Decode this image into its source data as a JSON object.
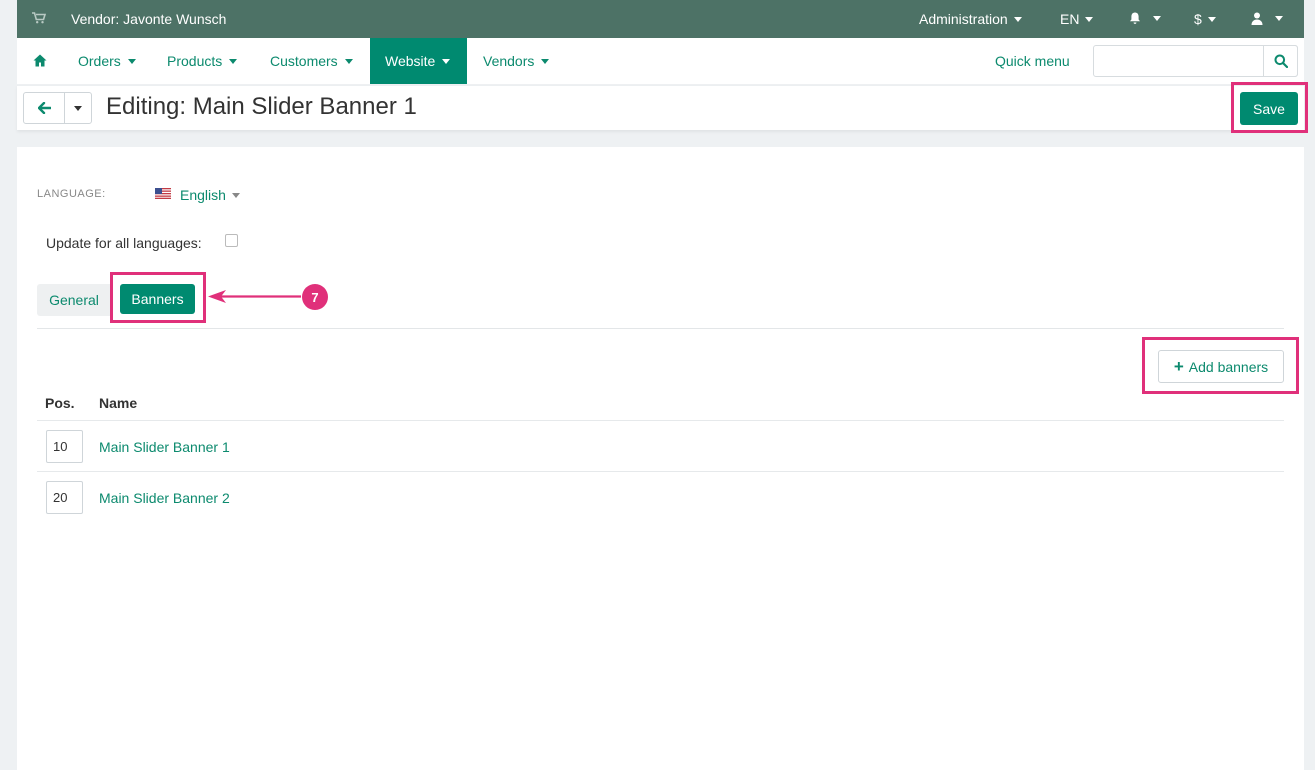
{
  "topbar": {
    "vendor": "Vendor: Javonte Wunsch",
    "administration": "Administration",
    "language_code": "EN",
    "currency": "$"
  },
  "nav": {
    "items": [
      {
        "label": "Orders"
      },
      {
        "label": "Products"
      },
      {
        "label": "Customers"
      },
      {
        "label": "Website",
        "active": true
      },
      {
        "label": "Vendors"
      }
    ],
    "quick_menu": "Quick menu",
    "search_placeholder": ""
  },
  "titlebar": {
    "title": "Editing: Main Slider Banner 1",
    "save_label": "Save"
  },
  "form": {
    "language_label": "LANGUAGE:",
    "language_value": "English",
    "update_all_label": "Update for all languages:",
    "update_all_checked": false
  },
  "tabs": [
    {
      "label": "General",
      "active": false
    },
    {
      "label": "Banners",
      "active": true
    }
  ],
  "add_button": "Add banners",
  "table": {
    "headers": [
      "Pos.",
      "Name"
    ],
    "rows": [
      {
        "pos": "10",
        "name": "Main Slider Banner 1"
      },
      {
        "pos": "20",
        "name": "Main Slider Banner 2"
      }
    ]
  },
  "annotation": {
    "step_number": "7",
    "color": "#e0307a"
  },
  "colors": {
    "topbar_bg": "#4d7266",
    "accent": "#008a70",
    "link": "#0c8a6e"
  },
  "icons": [
    "cart-icon",
    "bell-icon",
    "user-icon",
    "home-icon",
    "search-icon",
    "arrow-left-icon",
    "plus-icon",
    "us-flag-icon"
  ]
}
